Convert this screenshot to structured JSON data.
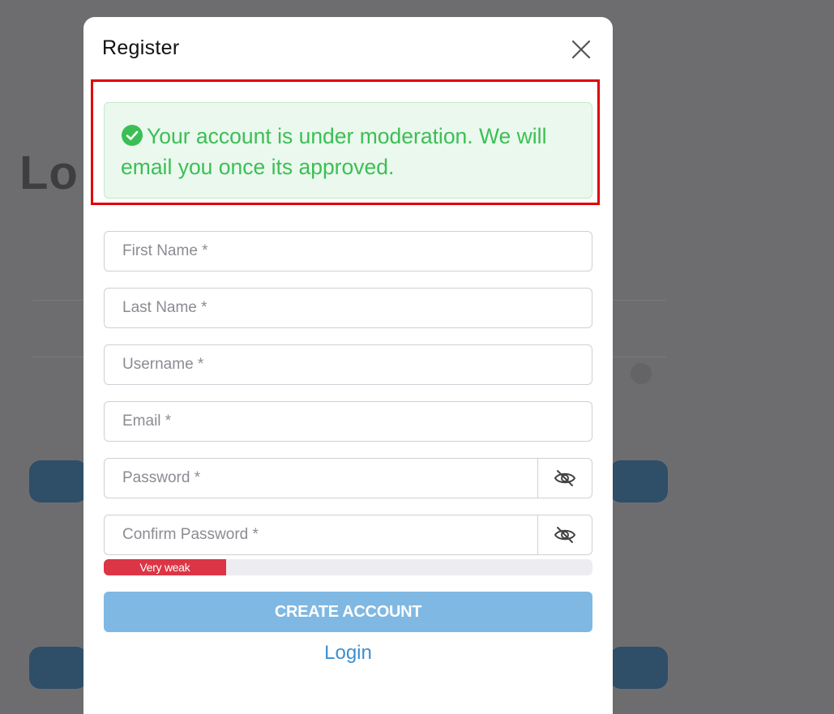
{
  "modal": {
    "title": "Register",
    "alert": {
      "message": "Your account is under moderation. We will email you once its approved."
    },
    "fields": {
      "first_name_placeholder": "First Name *",
      "last_name_placeholder": "Last Name *",
      "username_placeholder": "Username *",
      "email_placeholder": "Email *",
      "password_placeholder": "Password *",
      "confirm_password_placeholder": "Confirm Password *"
    },
    "password_strength": {
      "label": "Very weak",
      "level_percent": 25,
      "color": "#dc3545"
    },
    "create_account_label": "CREATE ACCOUNT",
    "login_link_label": "Login"
  },
  "colors": {
    "success_text": "#3bbf55",
    "success_bg": "#ebf8ee",
    "button_disabled": "#7fb8e2",
    "link": "#3d8fd0",
    "highlight": "#e00000"
  },
  "icons": {
    "close": "close-icon",
    "check": "check-circle-icon",
    "password_toggle": "eye-slash-icon"
  }
}
